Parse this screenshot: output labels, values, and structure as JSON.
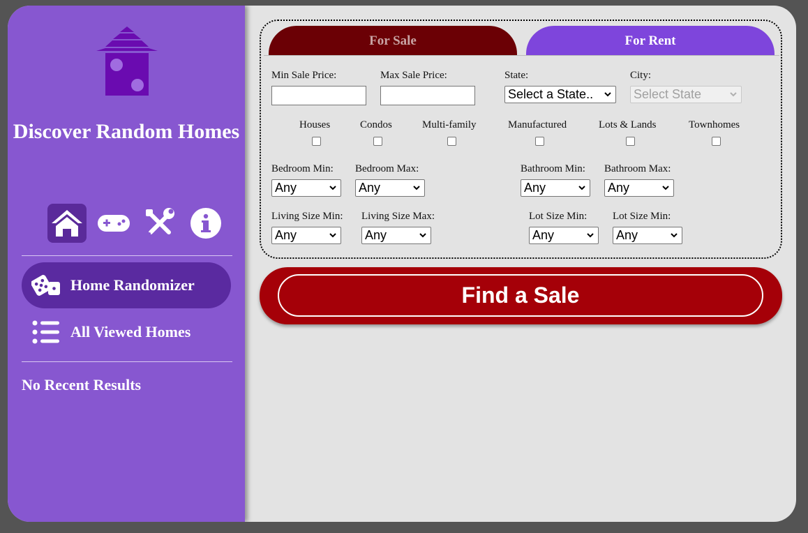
{
  "sidebar": {
    "title": "Discover Random Homes",
    "nav_icons": [
      "home-icon",
      "gamepad-icon",
      "tools-icon",
      "info-icon"
    ],
    "menu": [
      {
        "label": "Home Randomizer",
        "icon": "dice-icon",
        "active": true
      },
      {
        "label": "All Viewed Homes",
        "icon": "list-icon",
        "active": false
      }
    ],
    "recent_status": "No Recent Results"
  },
  "tabs": {
    "sale": "For Sale",
    "rent": "For Rent"
  },
  "filters": {
    "min_price_label": "Min Sale Price:",
    "min_price_value": "",
    "max_price_label": "Max Sale Price:",
    "max_price_value": "",
    "state_label": "State:",
    "state_value": "Select a State..",
    "city_label": "City:",
    "city_value": "Select State",
    "property_types": [
      "Houses",
      "Condos",
      "Multi-family",
      "Manufactured",
      "Lots & Lands",
      "Townhomes"
    ],
    "bedroom_min_label": "Bedroom Min:",
    "bedroom_min_value": "Any",
    "bedroom_max_label": "Bedroom Max:",
    "bedroom_max_value": "Any",
    "bathroom_min_label": "Bathroom Min:",
    "bathroom_min_value": "Any",
    "bathroom_max_label": "Bathroom Max:",
    "bathroom_max_value": "Any",
    "living_min_label": "Living Size Min:",
    "living_min_value": "Any",
    "living_max_label": "Living Size Max:",
    "living_max_value": "Any",
    "lot_min_label": "Lot Size Min:",
    "lot_min_value": "Any",
    "lot_min2_label": "Lot Size Min:",
    "lot_min2_value": "Any"
  },
  "find_button": "Find a Sale",
  "colors": {
    "sidebar": "#8757d0",
    "sidebar_active": "#5a2aa0",
    "sale_tab": "#6b0005",
    "rent_tab": "#7e45dc",
    "find_button": "#a50008",
    "logo": "#6a0bb0"
  }
}
